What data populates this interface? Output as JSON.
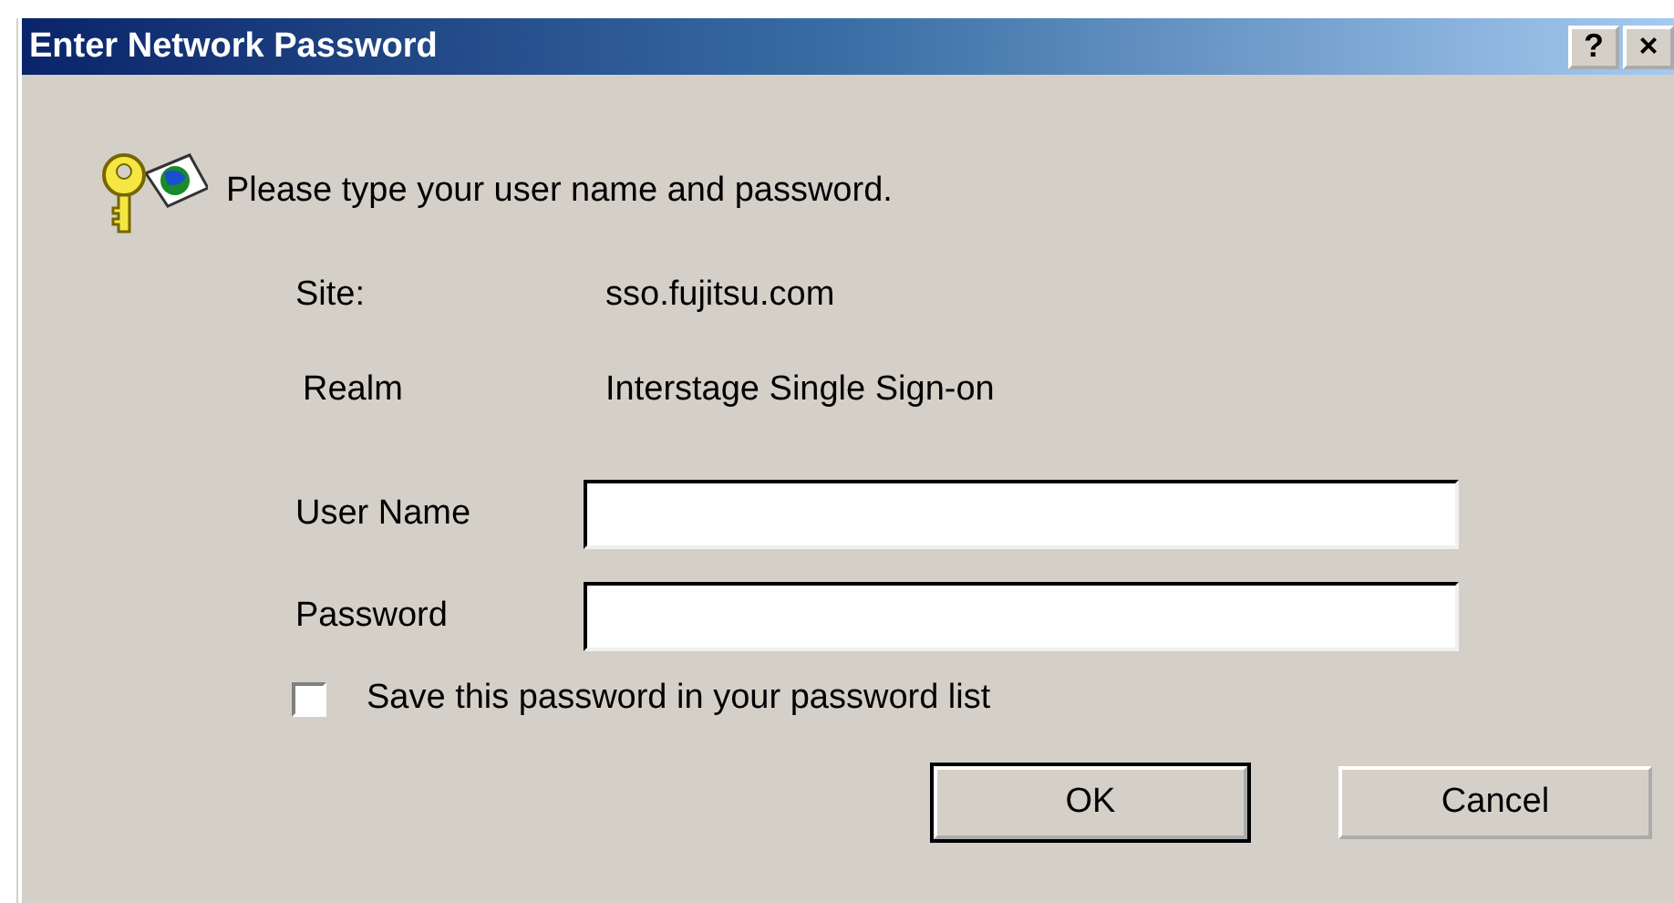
{
  "window": {
    "title": "Enter Network Password",
    "title_buttons": [
      "?",
      "×"
    ]
  },
  "prompt": "Please type your user name and password.",
  "info": [
    {
      "label": "Site:",
      "value": "sso.fujitsu.com"
    },
    {
      "label": "Realm",
      "value": "Interstage Single Sign-on"
    }
  ],
  "fields": [
    {
      "label": "User Name"
    },
    {
      "label": "Password"
    }
  ],
  "save_password": {
    "label": "Save this password in your password list",
    "checked": false
  },
  "buttons": [
    {
      "label": "OK",
      "default": true
    },
    {
      "label": "Cancel",
      "default": false
    }
  ]
}
